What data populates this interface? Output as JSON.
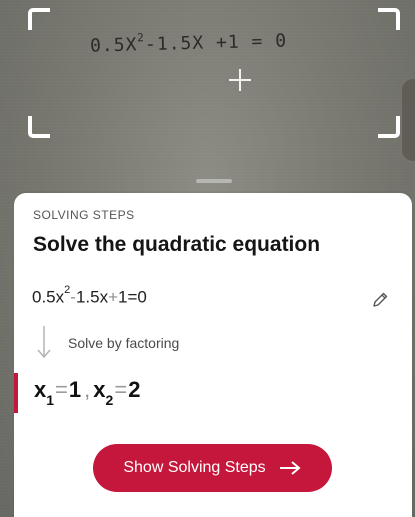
{
  "camera": {
    "handwritten_parts": {
      "coefficient": "0.5X",
      "power": "2",
      "rest": "-1.5X +1 = 0"
    }
  },
  "result": {
    "section_label": "SOLVING STEPS",
    "title": "Solve the quadratic equation",
    "equation": {
      "term1": "0.5x",
      "exp1": "2",
      "op1": "-",
      "term2": "1.5x",
      "op2": "+",
      "term3": "1",
      "eq_sign": "=",
      "rhs": "0"
    },
    "method": "Solve by factoring",
    "answer": {
      "var1": "x",
      "sub1": "1",
      "eq1": "=",
      "val1": "1",
      "separator": ",",
      "var2": "x",
      "sub2": "2",
      "eq2": "=",
      "val2": "2"
    },
    "button_label": "Show Solving Steps"
  },
  "icons": {
    "edit": "pencil-icon",
    "arrow_down": "arrow-down-icon",
    "arrow_right": "arrow-right-icon"
  },
  "colors": {
    "accent": "#c5173b"
  }
}
